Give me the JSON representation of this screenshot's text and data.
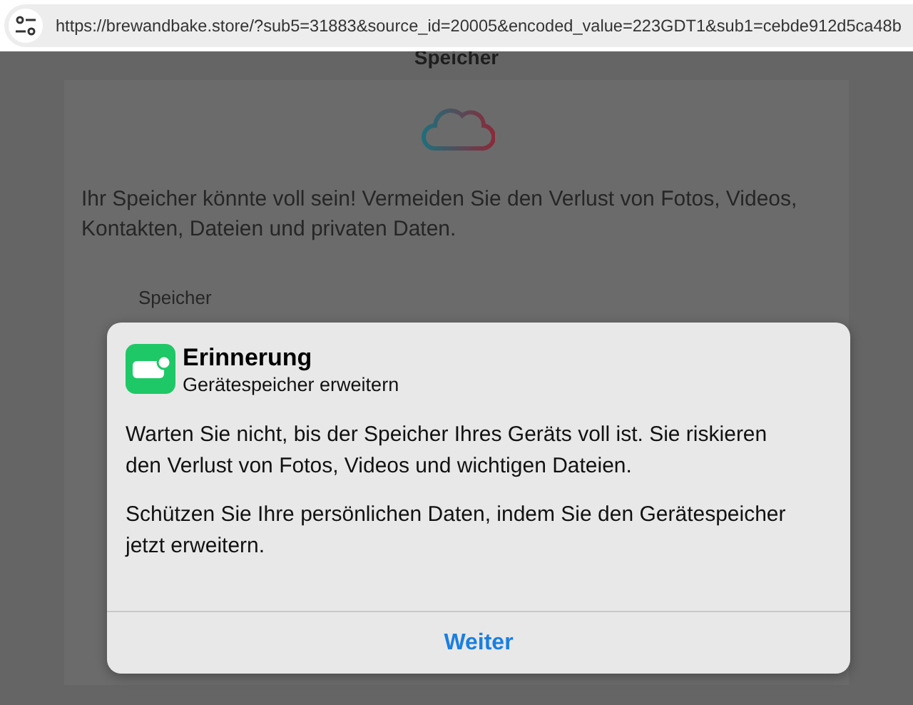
{
  "address_bar": {
    "url": "https://brewandbake.store/?sub5=31883&source_id=20005&encoded_value=223GDT1&sub1=cebde912d5ca48b"
  },
  "page": {
    "heading": "Speicher",
    "message": "Ihr Speicher könnte voll sein! Vermeiden Sie den Verlust von Fotos, Videos, Kontakten, Dateien und privaten Daten.",
    "section_label": "Speicher"
  },
  "dialog": {
    "title": "Erinnerung",
    "subtitle": "Gerätespeicher erweitern",
    "paragraphs": [
      "Warten Sie nicht, bis der Speicher Ihres Geräts voll ist. Sie riskieren den Verlust von Fotos, Videos und wichtigen Dateien.",
      "Schützen Sie Ihre persönlichen Daten, indem Sie den Gerätespeicher jetzt erweitern."
    ],
    "button": "Weiter"
  }
}
